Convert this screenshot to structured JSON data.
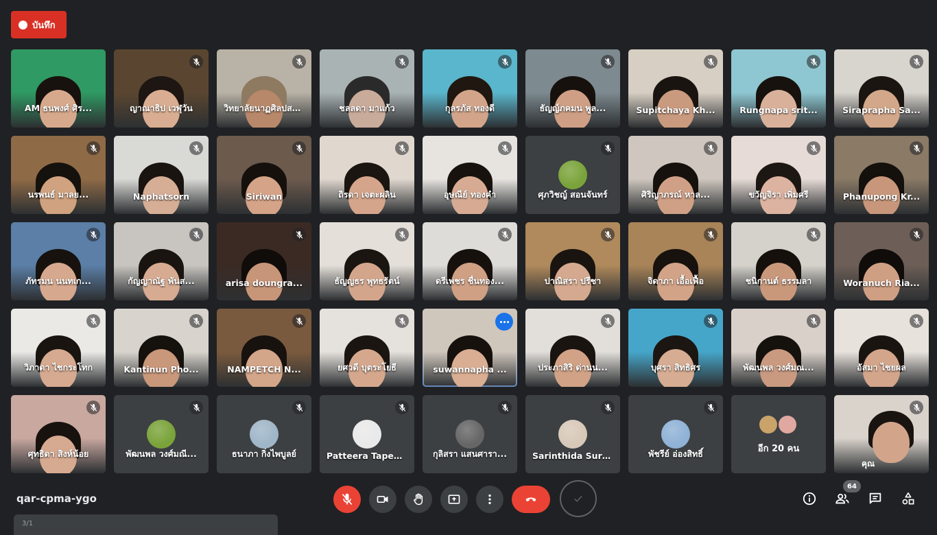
{
  "recording": {
    "label": "บันทึก",
    "color": "#d93025"
  },
  "meeting": {
    "code": "qar-cpma-ygo"
  },
  "participants_count": "64",
  "taskbar_peek": "3/1",
  "accent": "#1a73e8",
  "participants": [
    {
      "name": "AM ธนพงศ์ ศิร...",
      "type": "video",
      "bg": "#2f9a63",
      "skin": "#d7a98c",
      "hair": "#18120f",
      "muted": false
    },
    {
      "name": "ญาณาธิป เวฬุวัน",
      "type": "video",
      "bg": "#5a4630",
      "skin": "#d9ad91",
      "hair": "#1d1612",
      "muted": true
    },
    {
      "name": "วิทยาลัยนาฏศิลปสร...",
      "type": "video",
      "bg": "#b9b2a6",
      "skin": "#b8886a",
      "hair": "#8e7a61",
      "muted": true
    },
    {
      "name": "ชลลดา มาแก้ว",
      "type": "video",
      "bg": "#aab3b4",
      "skin": "#c9ab9a",
      "hair": "#2b2a2a",
      "muted": true
    },
    {
      "name": "กุลรภัส ทองดี",
      "type": "video",
      "bg": "#5ab6cc",
      "skin": "#d2a58a",
      "hair": "#201810",
      "muted": true
    },
    {
      "name": "ธัญญ์ภคมน พูล...",
      "type": "video",
      "bg": "#7d8a8f",
      "skin": "#cf9f85",
      "hair": "#16110d",
      "muted": true
    },
    {
      "name": "Supitchaya Kh...",
      "type": "video",
      "bg": "#d7cfc3",
      "skin": "#c99a7e",
      "hair": "#1a1410",
      "muted": true
    },
    {
      "name": "Rungnapa srit...",
      "type": "video",
      "bg": "#8ec7d1",
      "skin": "#d9b19a",
      "hair": "#17120e",
      "muted": true
    },
    {
      "name": "Siraprapha Sa...",
      "type": "video",
      "bg": "#d8d4ce",
      "skin": "#d3a789",
      "hair": "#1b1511",
      "muted": true
    },
    {
      "name": "นรพนธ์ มาลย...",
      "type": "video",
      "bg": "#8f6a46",
      "skin": "#d0a27f",
      "hair": "#15110d",
      "muted": true
    },
    {
      "name": "Naphatsorn",
      "type": "video",
      "bg": "#d9d9d6",
      "skin": "#d6ad95",
      "hair": "#1a1410",
      "muted": true
    },
    {
      "name": "Siriwan",
      "type": "video",
      "bg": "#6c5a4d",
      "skin": "#d5a387",
      "hair": "#15100c",
      "muted": true
    },
    {
      "name": "ถิรดา เจตะผลิน",
      "type": "video",
      "bg": "#e0d8cf",
      "skin": "#d4a58b",
      "hair": "#1b1511",
      "muted": true
    },
    {
      "name": "อุษณีย์ ทองคำ",
      "type": "video",
      "bg": "#e7e4e0",
      "skin": "#d7ab93",
      "hair": "#17120e",
      "muted": true
    },
    {
      "name": "ศุภวิชญ์ สอนจันทร์",
      "type": "avatar",
      "avatar": "#7aa33a",
      "muted": true
    },
    {
      "name": "ศิริญาภรณ์ หาล...",
      "type": "video",
      "bg": "#cfc7bf",
      "skin": "#d0a086",
      "hair": "#16110d",
      "muted": true
    },
    {
      "name": "ขวัญจิรา เพิ่มศรี",
      "type": "video",
      "bg": "#e6dbd6",
      "skin": "#dcb3a0",
      "hair": "#1d1713",
      "muted": true
    },
    {
      "name": "Phanupong Kr...",
      "type": "video",
      "bg": "#8a7a66",
      "skin": "#c8967a",
      "hair": "#14100c",
      "muted": true
    },
    {
      "name": "ภัทรมน นนทเก...",
      "type": "video",
      "bg": "#5b7fa7",
      "skin": "#d6a88e",
      "hair": "#17120e",
      "muted": true
    },
    {
      "name": "กัญญาณัฐ พันส...",
      "type": "video",
      "bg": "#c8c5c0",
      "skin": "#d7ab91",
      "hair": "#1a1410",
      "muted": true
    },
    {
      "name": "arisa doungra...",
      "type": "video",
      "bg": "#3b2a24",
      "skin": "#c79578",
      "hair": "#100c0a",
      "muted": true
    },
    {
      "name": "ธัญญธร พุทธรัตน์",
      "type": "video",
      "bg": "#e4dfd9",
      "skin": "#d3a68c",
      "hair": "#1b1511",
      "muted": true
    },
    {
      "name": "ดรีเพชร ชื่นทอง...",
      "type": "video",
      "bg": "#dedcd8",
      "skin": "#cfa084",
      "hair": "#16110d",
      "muted": true
    },
    {
      "name": "ปาณิสรา ปรีชา",
      "type": "video",
      "bg": "#b08a5c",
      "skin": "#d5a98f",
      "hair": "#1a1410",
      "muted": true
    },
    {
      "name": "จิดาภา เอื้อเฟื้อ",
      "type": "video",
      "bg": "#a98458",
      "skin": "#d2a387",
      "hair": "#17120e",
      "muted": true
    },
    {
      "name": "ชนิกานต์ ธรรมลา",
      "type": "video",
      "bg": "#d5d2cb",
      "skin": "#c9987b",
      "hair": "#15100c",
      "muted": true
    },
    {
      "name": "Woranuch Ria...",
      "type": "video",
      "bg": "#6d5f57",
      "skin": "#cf9f84",
      "hair": "#100c0a",
      "muted": true
    },
    {
      "name": "วิภาดา ไชกระโทก",
      "type": "video",
      "bg": "#eae9e6",
      "skin": "#d6aa90",
      "hair": "#1a1410",
      "muted": true
    },
    {
      "name": "Kantinun Pho...",
      "type": "video",
      "bg": "#d8d4cd",
      "skin": "#c9977a",
      "hair": "#15110d",
      "muted": true
    },
    {
      "name": "NAMPETCH N...",
      "type": "video",
      "bg": "#7a5a3e",
      "skin": "#d3a589",
      "hair": "#17120e",
      "muted": true
    },
    {
      "name": "ยศวดี บุตระโยธี",
      "type": "video",
      "bg": "#e5e1dc",
      "skin": "#d5a88d",
      "hair": "#1b1511",
      "muted": true
    },
    {
      "name": "suwannapha ...",
      "type": "video",
      "bg": "#cfc6bc",
      "skin": "#d9ae93",
      "hair": "#16110d",
      "muted": false,
      "speaking": true,
      "more": true
    },
    {
      "name": "ประภาสิริ ด่านน...",
      "type": "video",
      "bg": "#e2dfda",
      "skin": "#d1a286",
      "hair": "#1a1410",
      "muted": true
    },
    {
      "name": "บุศรา สิทธิศร",
      "type": "video",
      "bg": "#46a6c9",
      "skin": "#d6ac92",
      "hair": "#1c1612",
      "muted": true
    },
    {
      "name": "พัฒนพล วงศ์มณ...",
      "type": "video",
      "bg": "#d9d0c9",
      "skin": "#c99a80",
      "hair": "#15110d",
      "muted": true
    },
    {
      "name": "อัสมา ไชยผล",
      "type": "video",
      "bg": "#e8e2dc",
      "skin": "#d3a58a",
      "hair": "#1a1410",
      "muted": true
    },
    {
      "name": "ศุทธิดา สิงห์น้อย",
      "type": "video",
      "bg": "#c9a8a0",
      "skin": "#d6aa90",
      "hair": "#17120e",
      "muted": true
    },
    {
      "name": "พัฒนพล วงศ์มณี...",
      "type": "avatar",
      "avatar": "#7aa33a",
      "muted": true
    },
    {
      "name": "ธนาภา กิ่งไพบูลย์",
      "type": "avatar",
      "avatar": "#9fb6c8",
      "muted": true
    },
    {
      "name": "Patteera Tapeai...",
      "type": "avatar",
      "avatar": "#e9e9e9",
      "muted": true
    },
    {
      "name": "กุลิสรา แสนศารา...",
      "type": "avatar",
      "avatar": "#666666",
      "muted": true
    },
    {
      "name": "Sarinthida Sura...",
      "type": "avatar",
      "avatar": "#d8c8b8",
      "muted": true
    },
    {
      "name": "พัชรีย์ อ่องสิทธิ์",
      "type": "avatar",
      "avatar": "#8fb2d6",
      "muted": true
    },
    {
      "name": "อีก 20 คน",
      "type": "others",
      "muted": false
    },
    {
      "name": "คุณ",
      "type": "self",
      "bg": "#d9d3cc",
      "skin": "#d2a58a",
      "hair": "#1a1410",
      "muted": true
    }
  ]
}
